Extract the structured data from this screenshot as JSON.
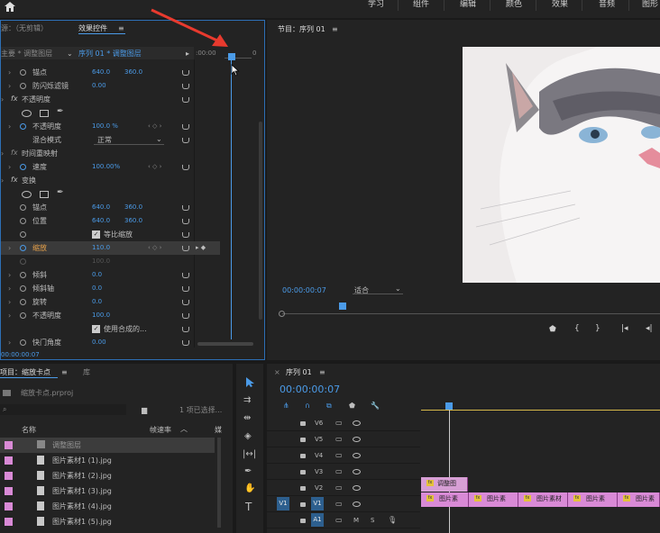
{
  "workspaces": [
    "学习",
    "组件",
    "编辑",
    "颜色",
    "效果",
    "音频",
    "图形"
  ],
  "panels": {
    "source_tab": "源：（无剪辑）",
    "effect_controls_tab": "效果控件",
    "program_title": "节目：序列 01",
    "project_tab": "项目：缩放卡点",
    "library_tab": "库",
    "timeline_tab": "序列 01"
  },
  "effect_controls": {
    "master_label": "主要 * 调整图层",
    "sequence_label": "序列 01 * 调整图层",
    "tl_start": ":00:00",
    "tl_end": "0",
    "rows": [
      {
        "label": "锚点",
        "v1": "640.0",
        "v2": "360.0"
      },
      {
        "label": "防闪烁滤镜",
        "v1": "0.00"
      },
      {
        "label": "不透明度",
        "section": true
      },
      {
        "label": "不透明度",
        "v1": "100.0 %"
      },
      {
        "label": "混合模式",
        "v1": "正常"
      },
      {
        "label": "时间重映射",
        "section": true
      },
      {
        "label": "速度",
        "v1": "100.00%"
      },
      {
        "label": "变换",
        "section": true
      },
      {
        "label": "锚点",
        "v1": "640.0",
        "v2": "360.0"
      },
      {
        "label": "位置",
        "v1": "640.0",
        "v2": "360.0"
      },
      {
        "label": "等比缩放"
      },
      {
        "label": "缩放",
        "v1": "110.0"
      },
      {
        "label": "",
        "v1": "100.0"
      },
      {
        "label": "倾斜",
        "v1": "0.0"
      },
      {
        "label": "倾斜轴",
        "v1": "0.0"
      },
      {
        "label": "旋转",
        "v1": "0.0"
      },
      {
        "label": "不透明度",
        "v1": "100.0"
      },
      {
        "label": "使用合成的..."
      },
      {
        "label": "快门角度",
        "v1": "0.00"
      }
    ],
    "timecode": "00:00:00:07"
  },
  "program": {
    "timecode": "00:00:00:07",
    "fit": "适合"
  },
  "project": {
    "filename": "缩放卡点.prproj",
    "selected_info": "1 项已选择...",
    "col_name": "名称",
    "col_fps": "帧速率",
    "col_extra": "媒",
    "items": [
      "调整图层",
      "图片素材1 (1).jpg",
      "图片素材1 (2).jpg",
      "图片素材1 (3).jpg",
      "图片素材1 (4).jpg",
      "图片素材1 (5).jpg"
    ]
  },
  "timeline": {
    "timecode": "00:00:00:07",
    "tracks": [
      "V6",
      "V5",
      "V4",
      "V3",
      "V2",
      "V1",
      "A1"
    ],
    "src_v1": "V1",
    "src_a1": "A1",
    "adjust_clip": "调整图",
    "clips": [
      "图片素",
      "图片素",
      "图片素材",
      "图片素",
      "图片素"
    ],
    "m": "M",
    "s": "S"
  },
  "colors": {
    "accent": "#2d6fb5",
    "clip": "#d98ad6",
    "blue_text": "#4b9be8"
  }
}
